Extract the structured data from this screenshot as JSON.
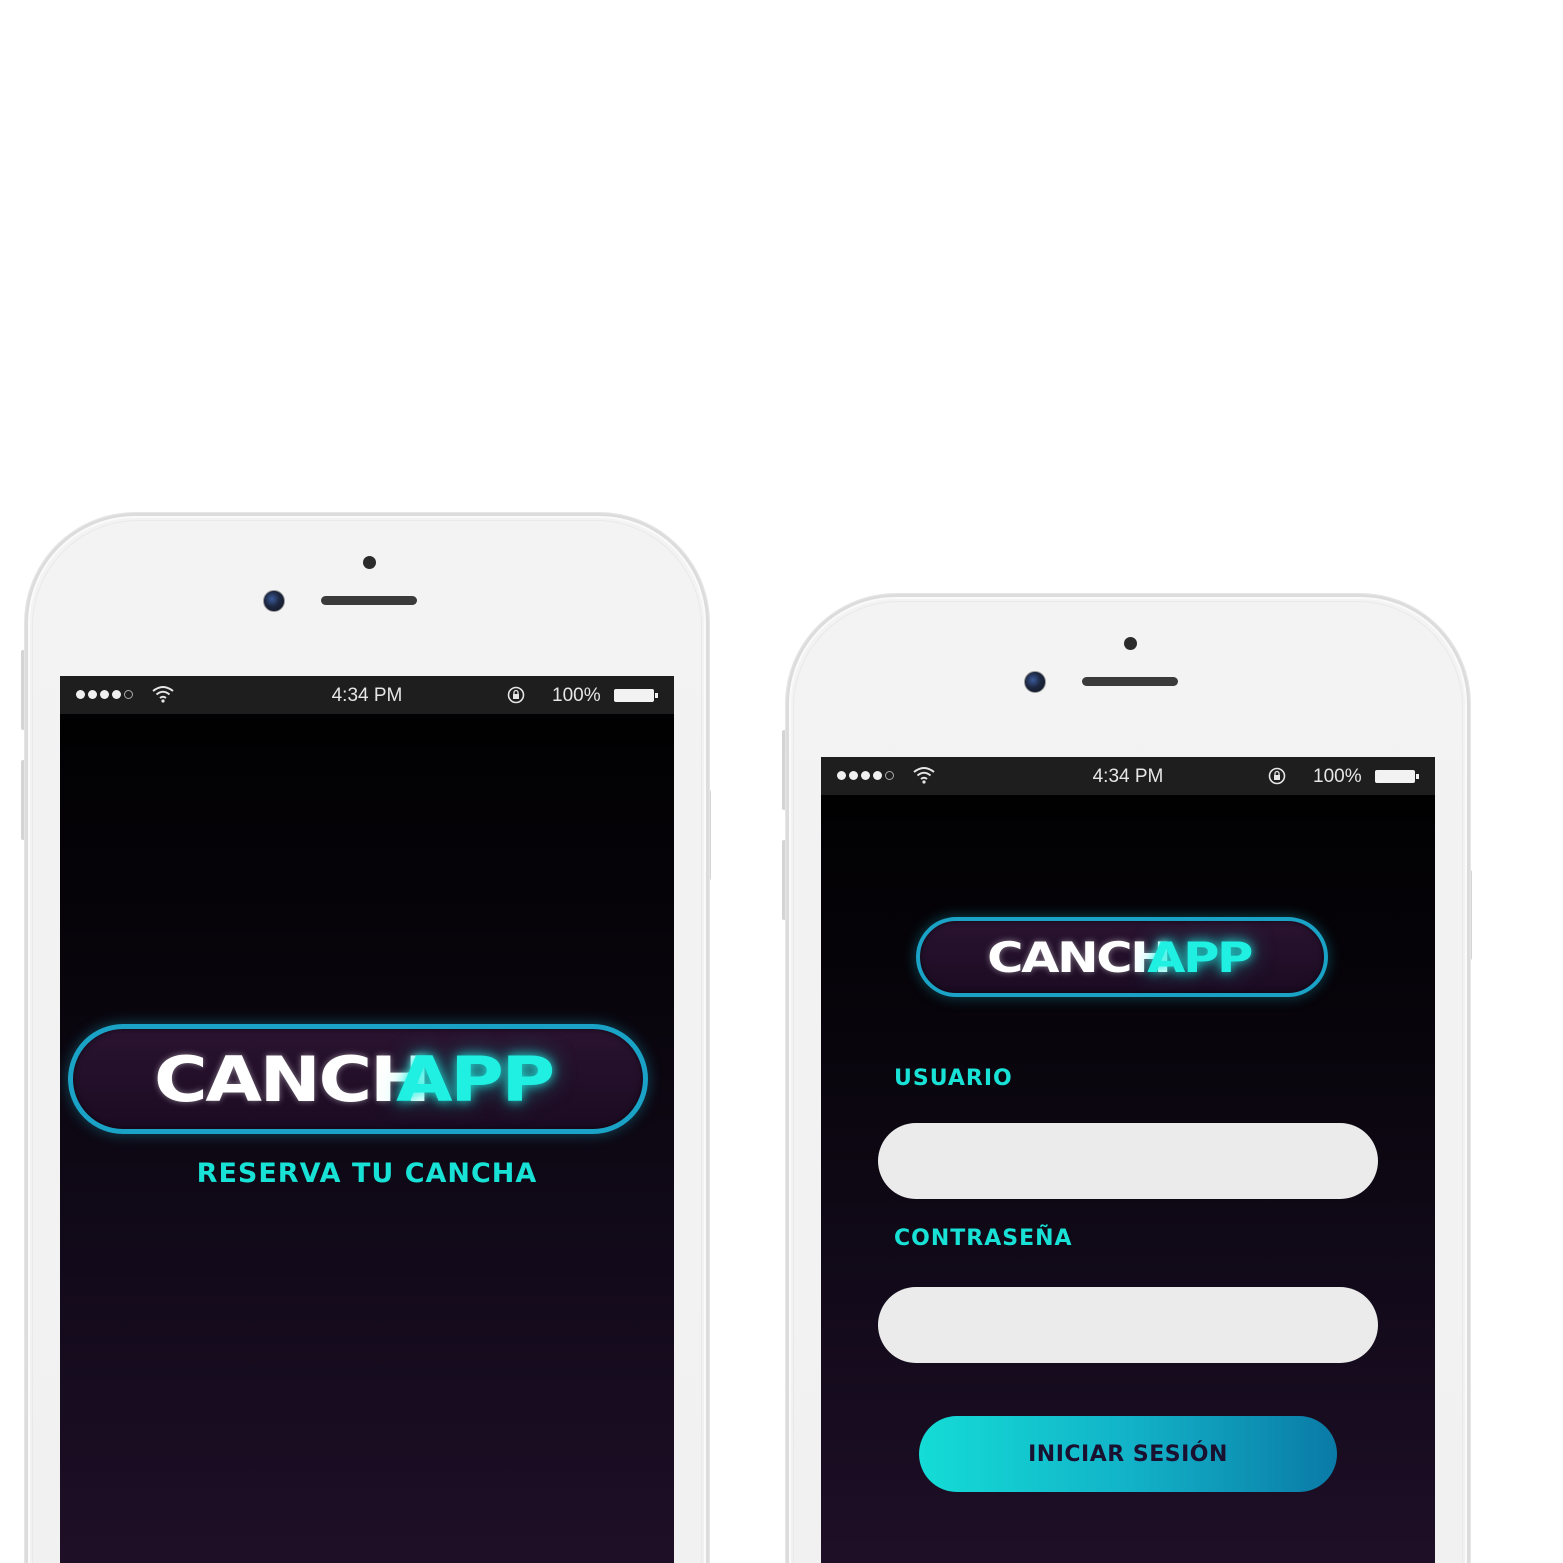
{
  "colors": {
    "accent_cyan": "#18e2d6",
    "logo_border": "#1aa3c6",
    "input_bg": "#ebebeb",
    "button_gradient_start": "#14dcd6",
    "button_gradient_end": "#0a7aa6",
    "screen_top": "#000000",
    "screen_bottom": "#1f0f28"
  },
  "status_bar": {
    "time": "4:34 PM",
    "battery": "100%",
    "icons": [
      "signal-icon",
      "wifi-icon",
      "lock-rotation-icon",
      "battery-icon"
    ]
  },
  "splash": {
    "logo_part1": "CANCH",
    "logo_part2": "APP",
    "tagline": "RESERVA TU CANCHA"
  },
  "login": {
    "logo_part1": "CANCH",
    "logo_part2": "APP",
    "username_label": "USUARIO",
    "username_value": "",
    "password_label": "CONTRASEÑA",
    "password_value": "",
    "submit_label": "INICIAR SESIÓN"
  }
}
